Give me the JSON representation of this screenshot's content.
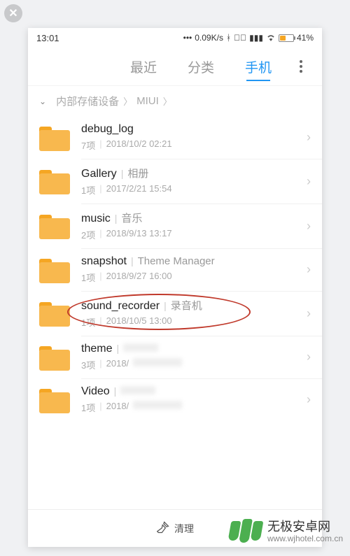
{
  "status": {
    "time": "13:01",
    "net_speed": "0.09K/s",
    "battery_pct": "41%"
  },
  "tabs": {
    "recent": "最近",
    "category": "分类",
    "phone": "手机",
    "active_index": 2
  },
  "breadcrumb": {
    "root": "内部存储设备",
    "folder": "MIUI"
  },
  "items": [
    {
      "name": "debug_log",
      "alias": "",
      "count": "7项",
      "date": "2018/10/2 02:21"
    },
    {
      "name": "Gallery",
      "alias": "相册",
      "count": "1项",
      "date": "2017/2/21 15:54"
    },
    {
      "name": "music",
      "alias": "音乐",
      "count": "2项",
      "date": "2018/9/13 13:17"
    },
    {
      "name": "snapshot",
      "alias": "Theme Manager",
      "count": "1项",
      "date": "2018/9/27 16:00"
    },
    {
      "name": "sound_recorder",
      "alias": "录音机",
      "count": "1项",
      "date": "2018/10/5 13:00",
      "highlighted": true
    },
    {
      "name": "theme",
      "alias": "",
      "count": "3项",
      "date": "2018/",
      "blurred": true
    },
    {
      "name": "Video",
      "alias": "",
      "count": "1项",
      "date": "2018/",
      "blurred": true
    }
  ],
  "bottom": {
    "clean": "清理"
  },
  "watermark": {
    "line1": "无极安卓网",
    "line2": "www.wjhotel.com.cn"
  }
}
